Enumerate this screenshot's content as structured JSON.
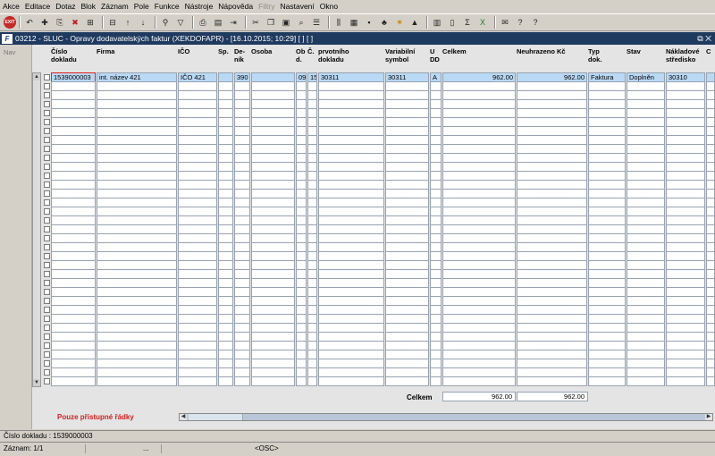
{
  "menu": [
    "Akce",
    "Editace",
    "Dotaz",
    "Blok",
    "Záznam",
    "Pole",
    "Funkce",
    "Nástroje",
    "Nápověda",
    "Filtry",
    "Nastavení",
    "Okno"
  ],
  "menu_disabled": [
    "Filtry"
  ],
  "toolbar": {
    "exit_label": "EXIT",
    "icons": [
      "undo-icon",
      "new-record-icon",
      "copy-record-icon",
      "delete-record-icon",
      "insert-icon",
      "delete-icon",
      "sort-asc-icon",
      "sort-desc-icon",
      "query-icon",
      "filter-icon",
      "print-icon",
      "print-preview-icon",
      "export-icon",
      "cut-icon",
      "copy-icon",
      "paste-icon",
      "find-icon",
      "list-icon",
      "split-icon",
      "calc-icon",
      "save-icon",
      "tree-icon",
      "star-icon",
      "pyramid-icon",
      "chart-icon",
      "doc-icon",
      "sum-icon",
      "excel-icon",
      "email-icon",
      "help-icon",
      "context-help-icon"
    ]
  },
  "window": {
    "logo": "F",
    "title": "03212 - SLUC - Opravy dodavatelských faktur (XEKDOFAPR) - [16.10.2015; 10:29] [ ] [ ]",
    "controls": "⧉ ✕"
  },
  "nav_label": "Nav",
  "columns": [
    {
      "key": "cislo",
      "label": "Číslo\ndokladu"
    },
    {
      "key": "firma",
      "label": "Firma"
    },
    {
      "key": "ico",
      "label": "IČO"
    },
    {
      "key": "sp",
      "label": "Sp."
    },
    {
      "key": "denik",
      "label": "De-\nník"
    },
    {
      "key": "osoba",
      "label": "Osoba"
    },
    {
      "key": "ob",
      "label": "Ob\nd."
    },
    {
      "key": "c",
      "label": "Č."
    },
    {
      "key": "prv",
      "label": "prvotního\ndokladu"
    },
    {
      "key": "var",
      "label": "Variabilní\nsymbol"
    },
    {
      "key": "udd",
      "label": "U\nDD"
    },
    {
      "key": "celkem",
      "label": "Celkem"
    },
    {
      "key": "neuhr",
      "label": "Neuhrazeno Kč"
    },
    {
      "key": "typ",
      "label": "Typ\ndok."
    },
    {
      "key": "stav",
      "label": "Stav"
    },
    {
      "key": "nak",
      "label": "Nákladové\nstředisko"
    },
    {
      "key": "extra",
      "label": "C"
    }
  ],
  "rows": [
    {
      "cislo": "1539000003",
      "firma": "int. název 421",
      "ico": "IČO 421",
      "sp": "",
      "denik": "390",
      "osoba": "",
      "ob": "09",
      "c": "15",
      "prv": "30311",
      "var": "30311",
      "udd": "A",
      "celkem": "962.00",
      "neuhr": "962.00",
      "typ": "Faktura",
      "stav": "Doplněn",
      "nak": "30310",
      "extra": ""
    }
  ],
  "empty_rows": 34,
  "totals": {
    "label": "Celkem",
    "celkem": "962.00",
    "neuhr": "962.00"
  },
  "warning": "Pouze přístupné řádky",
  "status": {
    "field": "Číslo dokladu : 1539000003",
    "record": "Záznam: 1/1",
    "seg2": "...",
    "osc": "<OSC>"
  }
}
